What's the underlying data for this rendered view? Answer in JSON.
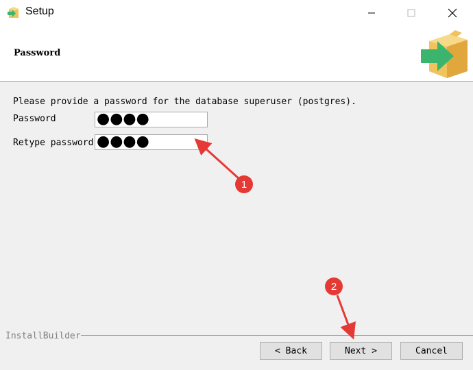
{
  "window": {
    "title": "Setup",
    "app_icon": "installer-arrow-icon",
    "controls": [
      "minimize-icon",
      "maximize-icon",
      "close-icon"
    ]
  },
  "header": {
    "title": "Password",
    "icon": "package-arrow-icon"
  },
  "form": {
    "instruction": "Please provide a password for the database superuser (postgres).",
    "password_label": "Password",
    "password_value": "●●●●",
    "retype_label": "Retype password",
    "retype_value": "●●●●"
  },
  "footer": {
    "brand": "InstallBuilder",
    "back_label": "< Back",
    "next_label": "Next >",
    "cancel_label": "Cancel"
  },
  "annotations": {
    "badge_1": "1",
    "badge_2": "2",
    "color": "#e53935"
  },
  "colors": {
    "background": "#f0f0f0",
    "header_bg": "#ffffff",
    "arrow_green": "#3bb56e",
    "box_tan": "#f2c25c"
  }
}
